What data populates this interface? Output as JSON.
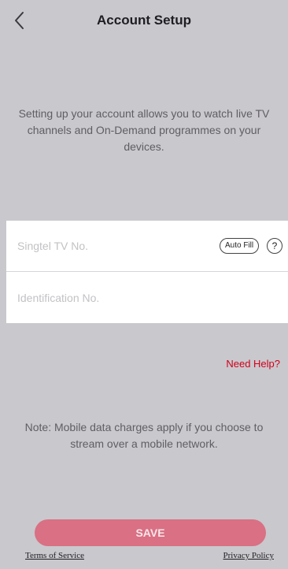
{
  "header": {
    "title": "Account Setup",
    "back_icon": "chevron-left-icon"
  },
  "intro": {
    "text": "Setting up your account allows you to watch live TV channels and On-Demand programmes on your devices."
  },
  "form": {
    "tv_number": {
      "placeholder": "Singtel TV No.",
      "value": "",
      "autofill_label": "Auto Fill",
      "help_label": "?"
    },
    "id_number": {
      "placeholder": "Identification No.",
      "value": ""
    }
  },
  "need_help": "Need Help?",
  "note": "Note: Mobile data charges apply if you choose to stream over a mobile network.",
  "save_label": "SAVE",
  "footer": {
    "terms": "Terms of Service",
    "privacy": "Privacy Policy"
  },
  "colors": {
    "background": "#c9c8cd",
    "accent": "#d97083",
    "link_red": "#d0001b"
  }
}
